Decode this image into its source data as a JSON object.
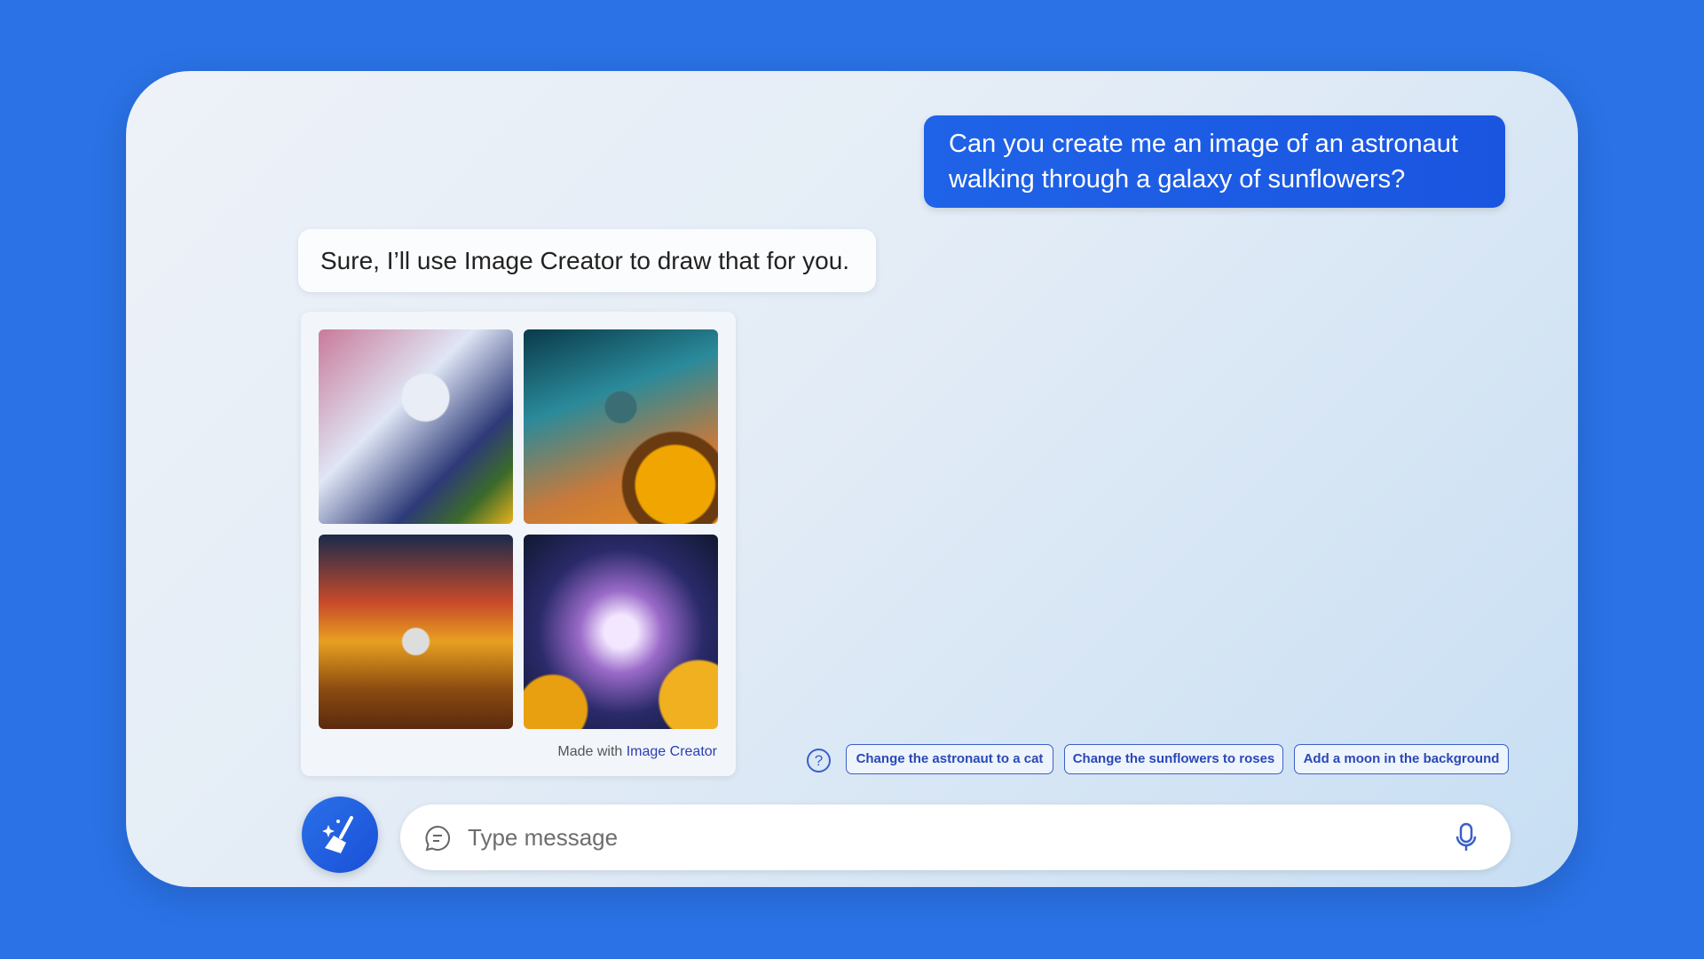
{
  "user_message": "Can you create me an image of an astronaut walking through a galaxy of sunflowers?",
  "bot_message": "Sure, I’ll use Image Creator to draw that for you.",
  "image_card": {
    "made_with": "Made with",
    "creator_link": "Image Creator",
    "images": [
      "astronaut-sunflowers-1",
      "astronaut-sunflowers-2",
      "astronaut-sunflowers-3",
      "astronaut-sunflowers-4"
    ]
  },
  "suggestions": [
    "Change the astronaut to a cat",
    "Change the sunflowers to roses",
    "Add a moon in the background"
  ],
  "help_icon": "?",
  "input": {
    "placeholder": "Type message"
  },
  "colors": {
    "background": "#2a72e6",
    "accent": "#1f63e8",
    "chip_text": "#2a48b8"
  }
}
